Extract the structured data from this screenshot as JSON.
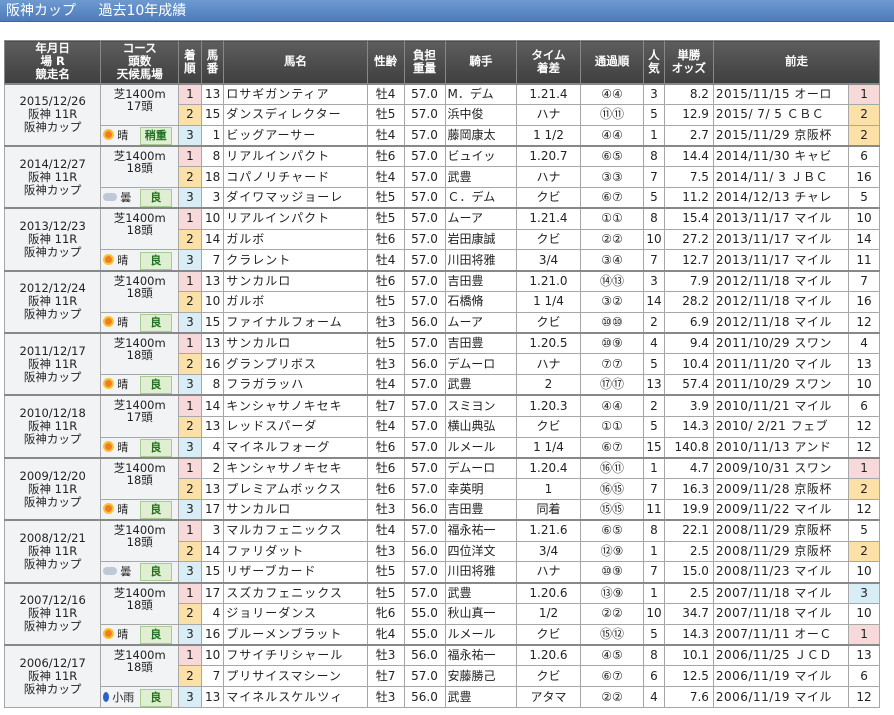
{
  "title": {
    "main": "阪神カップ",
    "sub": "過去10年成績"
  },
  "headers": [
    "年月日\n場 R\n競走名",
    "コース\n頭数\n天候馬場",
    "着\n順",
    "馬\n番",
    "馬名",
    "性齢",
    "負担\n重量",
    "騎手",
    "タイム\n着差",
    "通過順",
    "人\n気",
    "単勝\nオッズ",
    "前走"
  ],
  "races": [
    {
      "date": "2015/12/26",
      "place": "阪神 11R",
      "name": "阪神カップ",
      "course": "芝1400m",
      "heads": "17頭",
      "weather_icon": "sun-icon",
      "weather": "晴",
      "going": "稍重",
      "rows": [
        [
          "1",
          "13",
          "ロサギガンティア",
          "牡4",
          "57.0",
          "M．デム",
          "1.21.4",
          "④④",
          "3",
          "8.2",
          "2015/11/15 オーロ",
          "1"
        ],
        [
          "2",
          "15",
          "ダンスディレクター",
          "牡5",
          "57.0",
          "浜中俊",
          "ハナ",
          "⑪⑪",
          "5",
          "12.9",
          "2015/ 7/ 5 ＣＢＣ",
          "2"
        ],
        [
          "3",
          "1",
          "ビッグアーサー",
          "牡4",
          "57.0",
          "藤岡康太",
          "1 1/2",
          "④④",
          "1",
          "2.7",
          "2015/11/29 京阪杯",
          "2"
        ]
      ]
    },
    {
      "date": "2014/12/27",
      "place": "阪神 11R",
      "name": "阪神カップ",
      "course": "芝1400m",
      "heads": "18頭",
      "weather_icon": "cloud-icon",
      "weather": "曇",
      "going": "良",
      "rows": [
        [
          "1",
          "8",
          "リアルインパクト",
          "牡6",
          "57.0",
          "ビュイッ",
          "1.20.7",
          "⑥⑤",
          "8",
          "14.4",
          "2014/11/30 キャビ",
          "6"
        ],
        [
          "2",
          "18",
          "コパノリチャード",
          "牡4",
          "57.0",
          "武豊",
          "ハナ",
          "③③",
          "7",
          "7.5",
          "2014/11/ 3 ＪＢＣ",
          "16"
        ],
        [
          "3",
          "3",
          "ダイワマッジョーレ",
          "牡5",
          "57.0",
          "Ｃ．デム",
          "クビ",
          "⑥⑦",
          "5",
          "11.2",
          "2014/12/13 チャレ",
          "5"
        ]
      ]
    },
    {
      "date": "2013/12/23",
      "place": "阪神 11R",
      "name": "阪神カップ",
      "course": "芝1400m",
      "heads": "18頭",
      "weather_icon": "sun-icon",
      "weather": "晴",
      "going": "良",
      "rows": [
        [
          "1",
          "10",
          "リアルインパクト",
          "牡5",
          "57.0",
          "ムーア",
          "1.21.4",
          "①①",
          "8",
          "15.4",
          "2013/11/17 マイル",
          "10"
        ],
        [
          "2",
          "14",
          "ガルボ",
          "牡6",
          "57.0",
          "岩田康誠",
          "クビ",
          "②②",
          "10",
          "27.2",
          "2013/11/17 マイル",
          "14"
        ],
        [
          "3",
          "7",
          "クラレント",
          "牡4",
          "57.0",
          "川田将雅",
          "3/4",
          "③④",
          "7",
          "12.7",
          "2013/11/17 マイル",
          "11"
        ]
      ]
    },
    {
      "date": "2012/12/24",
      "place": "阪神 11R",
      "name": "阪神カップ",
      "course": "芝1400m",
      "heads": "18頭",
      "weather_icon": "sun-icon",
      "weather": "晴",
      "going": "良",
      "rows": [
        [
          "1",
          "13",
          "サンカルロ",
          "牡6",
          "57.0",
          "吉田豊",
          "1.21.0",
          "⑭⑬",
          "3",
          "7.9",
          "2012/11/18 マイル",
          "7"
        ],
        [
          "2",
          "10",
          "ガルボ",
          "牡5",
          "57.0",
          "石橋脩",
          "1 1/4",
          "③②",
          "14",
          "28.2",
          "2012/11/18 マイル",
          "16"
        ],
        [
          "3",
          "15",
          "ファイナルフォーム",
          "牡3",
          "56.0",
          "ムーア",
          "クビ",
          "⑩⑩",
          "2",
          "6.9",
          "2012/11/18 マイル",
          "12"
        ]
      ]
    },
    {
      "date": "2011/12/17",
      "place": "阪神 11R",
      "name": "阪神カップ",
      "course": "芝1400m",
      "heads": "18頭",
      "weather_icon": "sun-icon",
      "weather": "晴",
      "going": "良",
      "rows": [
        [
          "1",
          "13",
          "サンカルロ",
          "牡5",
          "57.0",
          "吉田豊",
          "1.20.5",
          "⑩⑨",
          "4",
          "9.4",
          "2011/10/29 スワン",
          "4"
        ],
        [
          "2",
          "16",
          "グランプリボス",
          "牡3",
          "56.0",
          "デムーロ",
          "ハナ",
          "⑦⑦",
          "5",
          "10.4",
          "2011/11/20 マイル",
          "13"
        ],
        [
          "3",
          "8",
          "フラガラッハ",
          "牡4",
          "57.0",
          "武豊",
          "2",
          "⑰⑰",
          "13",
          "57.4",
          "2011/10/29 スワン",
          "10"
        ]
      ]
    },
    {
      "date": "2010/12/18",
      "place": "阪神 11R",
      "name": "阪神カップ",
      "course": "芝1400m",
      "heads": "17頭",
      "weather_icon": "sun-icon",
      "weather": "晴",
      "going": "良",
      "rows": [
        [
          "1",
          "14",
          "キンシャサノキセキ",
          "牡7",
          "57.0",
          "スミヨン",
          "1.20.3",
          "④④",
          "2",
          "3.9",
          "2010/11/21 マイル",
          "6"
        ],
        [
          "2",
          "13",
          "レッドスパーダ",
          "牡4",
          "57.0",
          "横山典弘",
          "クビ",
          "①①",
          "5",
          "14.3",
          "2010/ 2/21 フェブ",
          "12"
        ],
        [
          "3",
          "4",
          "マイネルフォーグ",
          "牡6",
          "57.0",
          "ルメール",
          "1 1/4",
          "⑥⑦",
          "15",
          "140.8",
          "2010/11/13 アンド",
          "12"
        ]
      ]
    },
    {
      "date": "2009/12/20",
      "place": "阪神 11R",
      "name": "阪神カップ",
      "course": "芝1400m",
      "heads": "18頭",
      "weather_icon": "sun-icon",
      "weather": "晴",
      "going": "良",
      "rows": [
        [
          "1",
          "2",
          "キンシャサノキセキ",
          "牡6",
          "57.0",
          "デムーロ",
          "1.20.4",
          "⑯⑪",
          "1",
          "4.7",
          "2009/10/31 スワン",
          "1"
        ],
        [
          "2",
          "13",
          "プレミアムボックス",
          "牡6",
          "57.0",
          "幸英明",
          "1",
          "⑯⑮",
          "7",
          "16.3",
          "2009/11/28 京阪杯",
          "2"
        ],
        [
          "3",
          "17",
          "サンカルロ",
          "牡3",
          "56.0",
          "吉田豊",
          "同着",
          "⑮⑮",
          "11",
          "19.9",
          "2009/11/22 マイル",
          "12"
        ]
      ]
    },
    {
      "date": "2008/12/21",
      "place": "阪神 11R",
      "name": "阪神カップ",
      "course": "芝1400m",
      "heads": "18頭",
      "weather_icon": "cloud-icon",
      "weather": "曇",
      "going": "良",
      "rows": [
        [
          "1",
          "3",
          "マルカフェニックス",
          "牡4",
          "57.0",
          "福永祐一",
          "1.21.6",
          "⑥⑤",
          "8",
          "22.1",
          "2008/11/29 京阪杯",
          "5"
        ],
        [
          "2",
          "14",
          "ファリダット",
          "牡3",
          "56.0",
          "四位洋文",
          "3/4",
          "⑫⑨",
          "1",
          "2.5",
          "2008/11/29 京阪杯",
          "2"
        ],
        [
          "3",
          "15",
          "リザーブカード",
          "牡5",
          "57.0",
          "川田将雅",
          "ハナ",
          "⑩⑨",
          "7",
          "15.0",
          "2008/11/23 マイル",
          "10"
        ]
      ]
    },
    {
      "date": "2007/12/16",
      "place": "阪神 11R",
      "name": "阪神カップ",
      "course": "芝1400m",
      "heads": "18頭",
      "weather_icon": "sun-icon",
      "weather": "晴",
      "going": "良",
      "rows": [
        [
          "1",
          "17",
          "スズカフェニックス",
          "牡5",
          "57.0",
          "武豊",
          "1.20.6",
          "⑬⑨",
          "1",
          "2.5",
          "2007/11/18 マイル",
          "3"
        ],
        [
          "2",
          "4",
          "ジョリーダンス",
          "牝6",
          "55.0",
          "秋山真一",
          "1/2",
          "②②",
          "10",
          "34.7",
          "2007/11/18 マイル",
          "10"
        ],
        [
          "3",
          "16",
          "ブルーメンブラット",
          "牝4",
          "55.0",
          "ルメール",
          "クビ",
          "⑮⑫",
          "5",
          "14.3",
          "2007/11/11 オーＣ",
          "1"
        ]
      ]
    },
    {
      "date": "2006/12/17",
      "place": "阪神 11R",
      "name": "阪神カップ",
      "course": "芝1400m",
      "heads": "18頭",
      "weather_icon": "rain-icon",
      "weather": "小雨",
      "going": "良",
      "rows": [
        [
          "1",
          "10",
          "フサイチリシャール",
          "牡3",
          "56.0",
          "福永祐一",
          "1.20.6",
          "④⑤",
          "8",
          "10.1",
          "2006/11/25 ＪＣＤ",
          "13"
        ],
        [
          "2",
          "7",
          "プリサイスマシーン",
          "牡7",
          "57.0",
          "安藤勝己",
          "クビ",
          "⑥⑦",
          "6",
          "12.5",
          "2006/11/19 マイル",
          "6"
        ],
        [
          "3",
          "13",
          "マイネルスケルツィ",
          "牡3",
          "56.0",
          "武豊",
          "アタマ",
          "②②",
          "4",
          "7.6",
          "2006/11/19 マイル",
          "12"
        ]
      ]
    }
  ]
}
